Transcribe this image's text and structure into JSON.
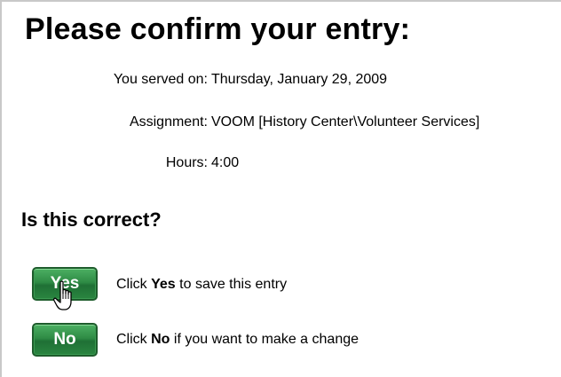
{
  "heading": "Please confirm your entry:",
  "details": {
    "served_label": "You served on:",
    "served_value": "Thursday, January 29, 2009",
    "assignment_label": "Assignment:",
    "assignment_value": "VOOM [History Center\\Volunteer Services]",
    "hours_label": "Hours:",
    "hours_value": "4:00"
  },
  "question": "Is this correct?",
  "actions": {
    "yes_label": "Yes",
    "yes_hint_before": "Click ",
    "yes_hint_bold": "Yes",
    "yes_hint_after": " to save this entry",
    "no_label": "No",
    "no_hint_before": "Click ",
    "no_hint_bold": "No",
    "no_hint_after": " if you want to make a change"
  },
  "colors": {
    "button_green": "#2e8b45",
    "button_border": "#1e5c2c"
  },
  "icons": {
    "cursor": "hand-pointer-icon"
  }
}
